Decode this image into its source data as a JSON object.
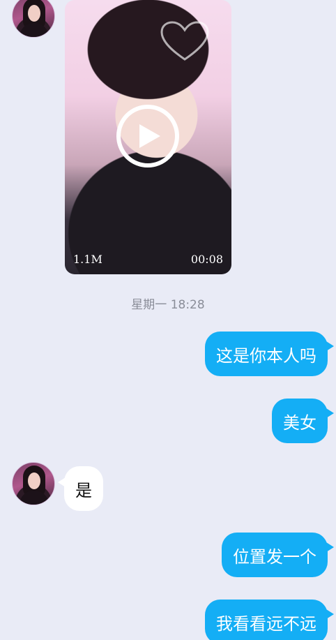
{
  "video": {
    "size": "1.1M",
    "duration": "00:08"
  },
  "timestamp": "星期一 18:28",
  "messages": [
    {
      "from": "me",
      "text": "这是你本人吗"
    },
    {
      "from": "me",
      "text": "美女"
    },
    {
      "from": "other",
      "text": "是"
    },
    {
      "from": "me",
      "text": "位置发一个"
    },
    {
      "from": "me",
      "text": "我看看远不远"
    }
  ],
  "colors": {
    "background": "#e9ebf6",
    "outgoing_bubble": "#14aef5",
    "incoming_bubble": "#ffffff",
    "timestamp_text": "#8a8d98"
  }
}
